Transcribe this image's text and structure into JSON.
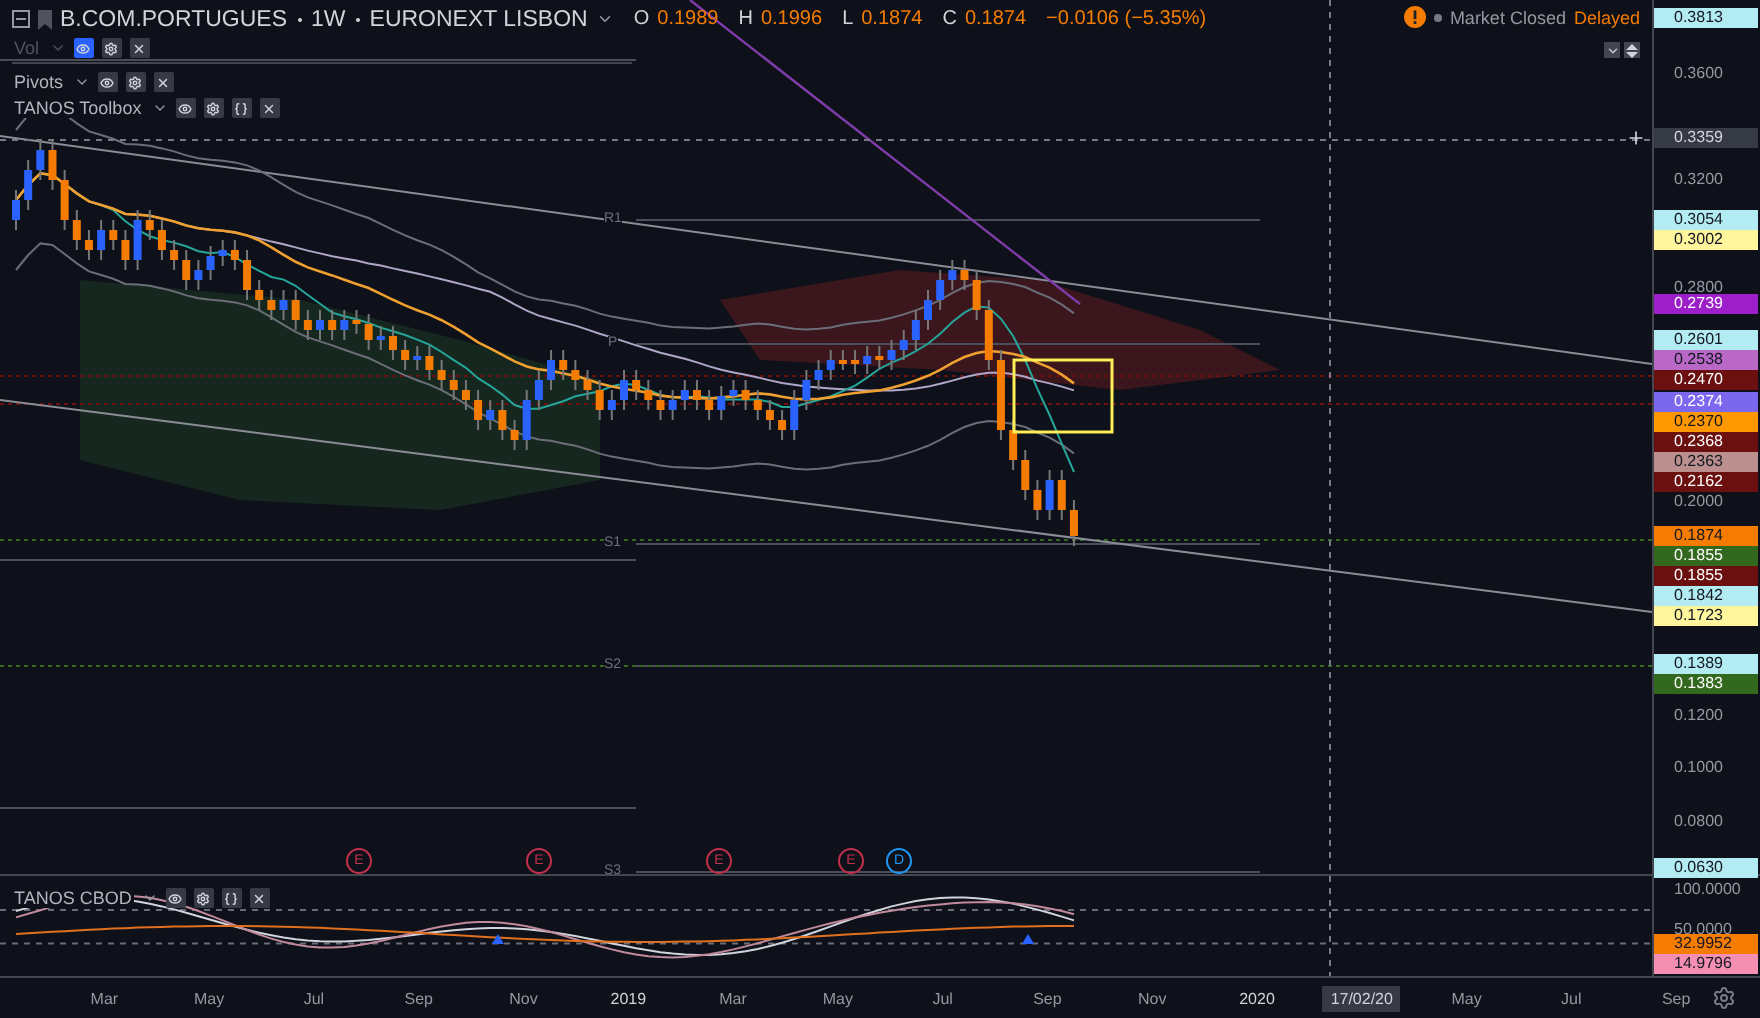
{
  "symbol": {
    "name": "B.COM.PORTUGUES",
    "interval": "1W",
    "exchange": "EURONEXT LISBON"
  },
  "ohlc": [
    {
      "label": "O",
      "value": "0.1989"
    },
    {
      "label": "H",
      "value": "0.1996"
    },
    {
      "label": "L",
      "value": "0.1874"
    },
    {
      "label": "C",
      "value": "0.1874"
    }
  ],
  "change": "−0.0106 (−5.35%)",
  "market_status": {
    "state": "Market Closed",
    "feed": "Delayed"
  },
  "studies": [
    {
      "name": "Vol",
      "hidden": true,
      "kind": "builtin"
    },
    {
      "name": "Pivots",
      "hidden": false,
      "kind": "builtin"
    },
    {
      "name": "TANOS Toolbox",
      "hidden": false,
      "kind": "script"
    }
  ],
  "pivot_labels": [
    "R1",
    "P",
    "S1",
    "S2",
    "S3"
  ],
  "events": [
    {
      "letter": "E",
      "kind": "earnings"
    },
    {
      "letter": "E",
      "kind": "earnings"
    },
    {
      "letter": "E",
      "kind": "earnings"
    },
    {
      "letter": "E",
      "kind": "earnings"
    },
    {
      "letter": "D",
      "kind": "dividend"
    }
  ],
  "price_axis": {
    "ticks": [
      "0.3600",
      "0.3200",
      "0.2800",
      "0.2000",
      "0.1200",
      "0.1000",
      "0.0800"
    ],
    "crosshair": "0.3359",
    "badges": [
      {
        "value": "0.3813",
        "color": "#b2ebf2"
      },
      {
        "value": "0.3054",
        "color": "#b2ebf2"
      },
      {
        "value": "0.3002",
        "color": "#fff59d"
      },
      {
        "value": "0.2739",
        "color": "#9c1fc9"
      },
      {
        "value": "0.2601",
        "color": "#b2ebf2"
      },
      {
        "value": "0.2538",
        "color": "#ba68c8"
      },
      {
        "value": "0.2470",
        "color": "#6b0f0f"
      },
      {
        "value": "0.2374",
        "color": "#7b68ee"
      },
      {
        "value": "0.2370",
        "color": "#ff9800"
      },
      {
        "value": "0.2368",
        "color": "#6b0f0f"
      },
      {
        "value": "0.2363",
        "color": "#bc8f8f"
      },
      {
        "value": "0.2162",
        "color": "#6b0f0f"
      },
      {
        "value": "0.1874",
        "color": "#f57c00"
      },
      {
        "value": "0.1855",
        "color": "#33691e"
      },
      {
        "value": "0.1855",
        "color": "#6b0f0f"
      },
      {
        "value": "0.1842",
        "color": "#b2ebf2"
      },
      {
        "value": "0.1723",
        "color": "#fff59d"
      },
      {
        "value": "0.1389",
        "color": "#b2ebf2"
      },
      {
        "value": "0.1383",
        "color": "#33691e"
      },
      {
        "value": "0.0630",
        "color": "#b2ebf2"
      }
    ]
  },
  "indicator": {
    "name": "TANOS CBOD",
    "hidden": false,
    "kind": "script",
    "ticks": [
      "100.0000",
      "50.0000"
    ],
    "badges": [
      {
        "value": "32.9952",
        "color": "#f57c00"
      },
      {
        "value": "14.9796",
        "color": "#f48fb1"
      }
    ]
  },
  "time_axis": {
    "labels": [
      {
        "text": "Mar",
        "kind": "tick"
      },
      {
        "text": "May",
        "kind": "tick"
      },
      {
        "text": "Jul",
        "kind": "tick"
      },
      {
        "text": "Sep",
        "kind": "tick"
      },
      {
        "text": "Nov",
        "kind": "tick"
      },
      {
        "text": "2019",
        "kind": "year"
      },
      {
        "text": "Mar",
        "kind": "tick"
      },
      {
        "text": "May",
        "kind": "tick"
      },
      {
        "text": "Jul",
        "kind": "tick"
      },
      {
        "text": "Sep",
        "kind": "tick"
      },
      {
        "text": "Nov",
        "kind": "tick"
      },
      {
        "text": "2020",
        "kind": "year"
      },
      {
        "text": "17/02/20",
        "kind": "crosshair"
      },
      {
        "text": "May",
        "kind": "tick"
      },
      {
        "text": "Jul",
        "kind": "tick"
      },
      {
        "text": "Sep",
        "kind": "tick"
      }
    ]
  }
}
